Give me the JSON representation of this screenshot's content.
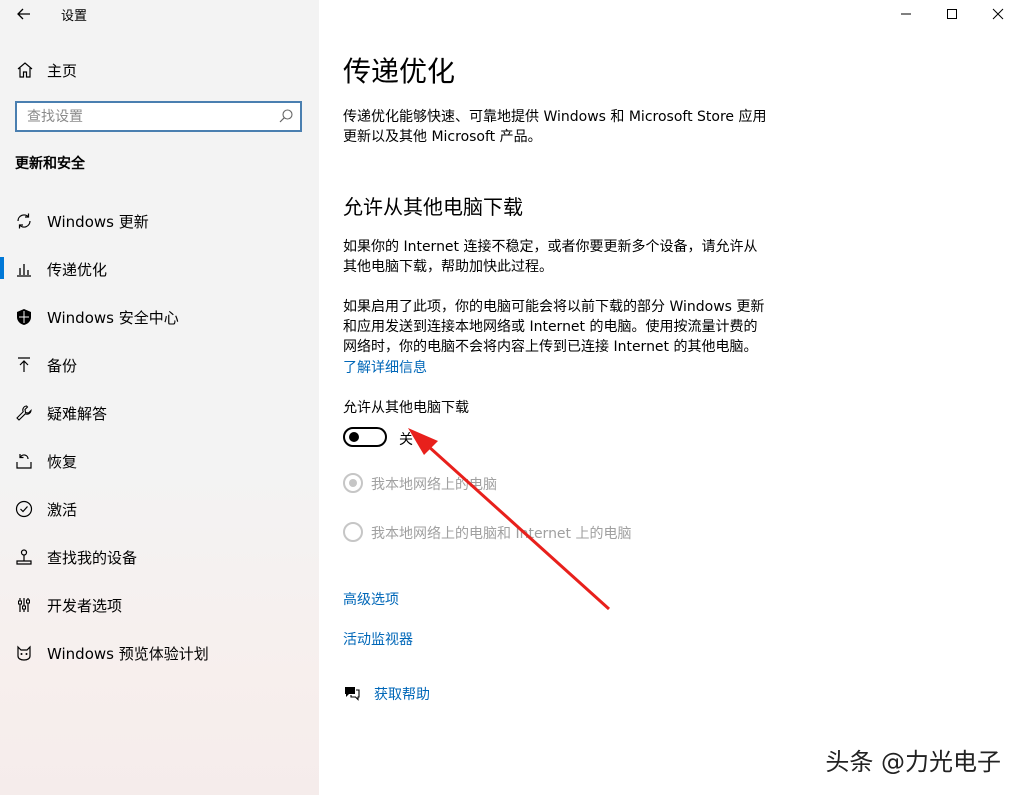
{
  "app": {
    "title": "设置"
  },
  "sidebar": {
    "home_label": "主页",
    "search_placeholder": "查找设置",
    "section_title": "更新和安全",
    "items": [
      {
        "label": "Windows 更新",
        "icon": "sync-icon"
      },
      {
        "label": "传递优化",
        "icon": "delivery-optimization-icon",
        "selected": true
      },
      {
        "label": "Windows 安全中心",
        "icon": "shield-icon"
      },
      {
        "label": "备份",
        "icon": "backup-arrow-icon"
      },
      {
        "label": "疑难解答",
        "icon": "wrench-icon"
      },
      {
        "label": "恢复",
        "icon": "recovery-icon"
      },
      {
        "label": "激活",
        "icon": "check-circle-icon"
      },
      {
        "label": "查找我的设备",
        "icon": "find-device-icon"
      },
      {
        "label": "开发者选项",
        "icon": "developer-sliders-icon"
      },
      {
        "label": "Windows 预览体验计划",
        "icon": "insider-cat-icon"
      }
    ]
  },
  "main": {
    "title": "传递优化",
    "intro_line1": "传递优化能够快速、可靠地提供 Windows 和 Microsoft Store 应用",
    "intro_line2": "更新以及其他 Microsoft 产品。",
    "section_title": "允许从其他电脑下载",
    "p1_line1": "如果你的 Internet 连接不稳定，或者你要更新多个设备，请允许从",
    "p1_line2": "其他电脑下载，帮助加快此过程。",
    "p2_line1": "如果启用了此项，你的电脑可能会将以前下载的部分 Windows 更新",
    "p2_line2": "和应用发送到连接本地网络或 Internet 的电脑。使用按流量计费的",
    "p2_line3": "网络时，你的电脑不会将内容上传到已连接 Internet 的其他电脑。",
    "learn_more": "了解详细信息",
    "toggle_label": "允许从其他电脑下载",
    "toggle_state": "关",
    "toggle_on": false,
    "radio_local": "我本地网络上的电脑",
    "radio_internet": "我本地网络上的电脑和 Internet 上的电脑",
    "advanced_options": "高级选项",
    "activity_monitor": "活动监视器",
    "get_help": "获取帮助"
  },
  "watermark": "头条 @力光电子",
  "colors": {
    "accent": "#0078d7",
    "link": "#0067b8",
    "annotation_arrow": "#e8201c"
  }
}
